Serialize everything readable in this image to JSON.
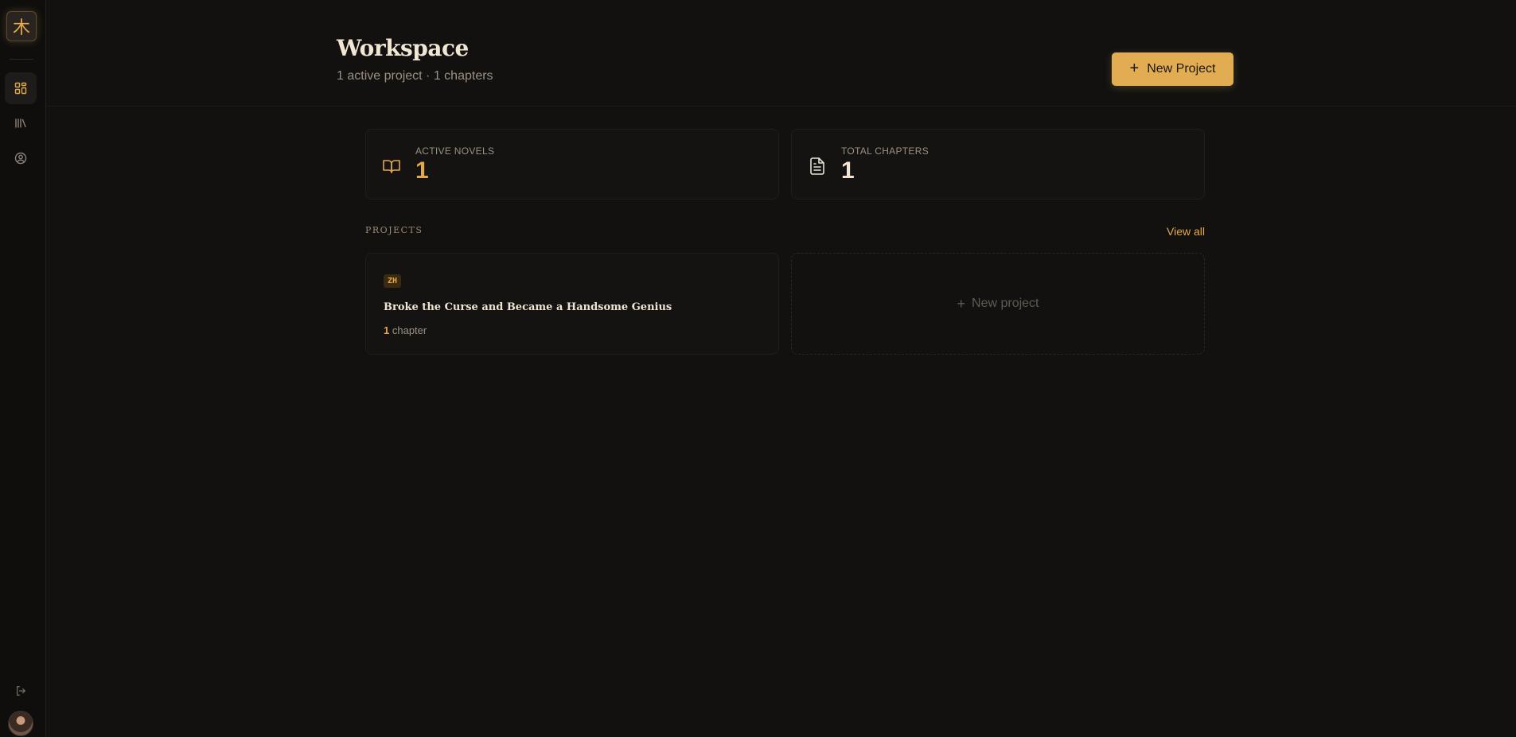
{
  "sidebar": {
    "logo_glyph": "木",
    "nav": [
      {
        "name": "dashboard",
        "icon": "grid-icon",
        "active": true
      },
      {
        "name": "library",
        "icon": "library-icon",
        "active": false
      },
      {
        "name": "profile",
        "icon": "user-circle-icon",
        "active": false
      }
    ],
    "logout_icon": "logout-icon"
  },
  "header": {
    "title": "Workspace",
    "subtitle": "1 active project · 1 chapters",
    "new_project_label": "New Project"
  },
  "stats": [
    {
      "label": "ACTIVE NOVELS",
      "value": "1",
      "icon": "book-open-icon",
      "value_color": "#e2a94a"
    },
    {
      "label": "TOTAL CHAPTERS",
      "value": "1",
      "icon": "document-icon",
      "value_color": "#f1e6d3"
    }
  ],
  "projects_section": {
    "label": "PROJECTS",
    "view_all": "View all",
    "items": [
      {
        "lang": "ZH",
        "title": "Broke the Curse and Became a Handsome Genius",
        "chapter_count": "1",
        "chapter_word": "chapter"
      }
    ],
    "new_project_label": "New project"
  },
  "colors": {
    "accent": "#e2ad52",
    "background": "#121110",
    "sidebar": "#0f0e0d"
  }
}
